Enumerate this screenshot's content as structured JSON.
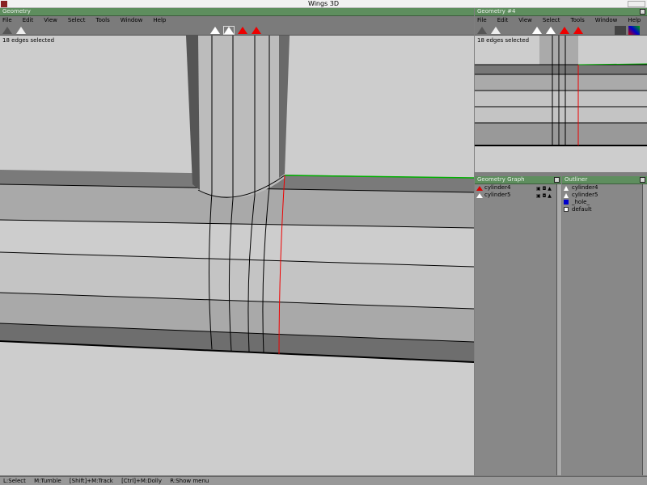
{
  "app_title": "Wings 3D",
  "main_window": {
    "title": "Geometry",
    "menu": [
      "File",
      "Edit",
      "View",
      "Select",
      "Tools",
      "Window",
      "Help"
    ],
    "status": "18 edges selected"
  },
  "second_window": {
    "title": "Geometry #4",
    "menu": [
      "File",
      "Edit",
      "View",
      "Select",
      "Tools",
      "Window",
      "Help"
    ],
    "status": "18 edges selected"
  },
  "geometry_graph": {
    "title": "Geometry Graph",
    "items": [
      {
        "label": "cylinder4",
        "icon": "red-object-icon"
      },
      {
        "label": "cylinder5",
        "icon": "white-object-icon"
      }
    ]
  },
  "outliner": {
    "title": "Outliner",
    "items": [
      {
        "label": "cylinder4",
        "icon": "object-icon"
      },
      {
        "label": "cylinder5",
        "icon": "object-icon"
      },
      {
        "label": "_hole_",
        "icon": "blue-material-icon"
      },
      {
        "label": "default",
        "icon": "material-icon"
      }
    ]
  },
  "statusbar": [
    "L:Select",
    "M:Tumble",
    "[Shift]+M:Track",
    "[Ctrl]+M:Dolly",
    "R:Show menu"
  ],
  "colors": {
    "selected_edge": "#ff0000",
    "title_green": "#5e8e5e"
  }
}
